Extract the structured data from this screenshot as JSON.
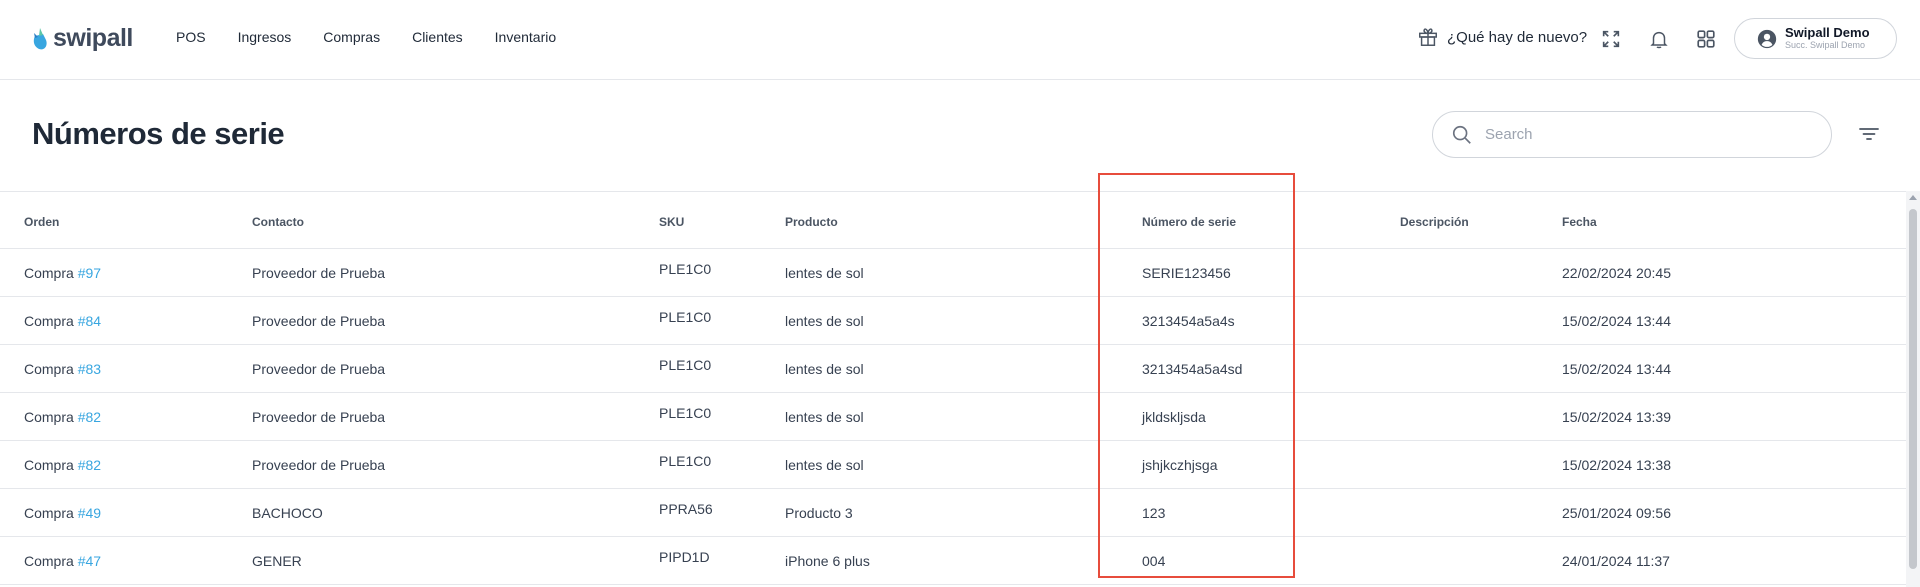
{
  "brand": {
    "name": "swipall",
    "accent": "#38a6e0"
  },
  "nav": {
    "items": [
      {
        "label": "POS"
      },
      {
        "label": "Ingresos"
      },
      {
        "label": "Compras"
      },
      {
        "label": "Clientes"
      },
      {
        "label": "Inventario"
      }
    ]
  },
  "header": {
    "whats_new": "¿Qué hay de nuevo?",
    "icons": [
      "gift-icon",
      "fullscreen-icon",
      "bell-icon",
      "apps-grid-icon",
      "user-circle-icon"
    ]
  },
  "user": {
    "name": "Swipall Demo",
    "branch": "Succ. Swipall Demo"
  },
  "page": {
    "title": "Números de serie"
  },
  "search": {
    "placeholder": "Search",
    "value": ""
  },
  "table": {
    "columns": [
      "Orden",
      "Contacto",
      "SKU",
      "Producto",
      "Número de serie",
      "Descripción",
      "Fecha"
    ],
    "rows": [
      {
        "order_prefix": "Compra",
        "order_num": "#97",
        "contact": "Proveedor de Prueba",
        "sku": "PLE1C0",
        "product": "lentes de sol",
        "serial": "SERIE123456",
        "description": "",
        "date": "22/02/2024 20:45"
      },
      {
        "order_prefix": "Compra",
        "order_num": "#84",
        "contact": "Proveedor de Prueba",
        "sku": "PLE1C0",
        "product": "lentes de sol",
        "serial": "3213454a5a4s",
        "description": "",
        "date": "15/02/2024 13:44"
      },
      {
        "order_prefix": "Compra",
        "order_num": "#83",
        "contact": "Proveedor de Prueba",
        "sku": "PLE1C0",
        "product": "lentes de sol",
        "serial": "3213454a5a4sd",
        "description": "",
        "date": "15/02/2024 13:44"
      },
      {
        "order_prefix": "Compra",
        "order_num": "#82",
        "contact": "Proveedor de Prueba",
        "sku": "PLE1C0",
        "product": "lentes de sol",
        "serial": "jkldskljsda",
        "description": "",
        "date": "15/02/2024 13:39"
      },
      {
        "order_prefix": "Compra",
        "order_num": "#82",
        "contact": "Proveedor de Prueba",
        "sku": "PLE1C0",
        "product": "lentes de sol",
        "serial": "jshjkczhjsga",
        "description": "",
        "date": "15/02/2024 13:38"
      },
      {
        "order_prefix": "Compra",
        "order_num": "#49",
        "contact": "BACHOCO",
        "sku": "PPRA56",
        "product": "Producto 3",
        "serial": "123",
        "description": "",
        "date": "25/01/2024 09:56"
      },
      {
        "order_prefix": "Compra",
        "order_num": "#47",
        "contact": "GENER",
        "sku": "PIPD1D",
        "product": "iPhone 6 plus",
        "serial": "004",
        "description": "",
        "date": "24/01/2024 11:37"
      }
    ]
  },
  "colors": {
    "highlight": "#e74c3c",
    "border": "#e5e7eb"
  }
}
